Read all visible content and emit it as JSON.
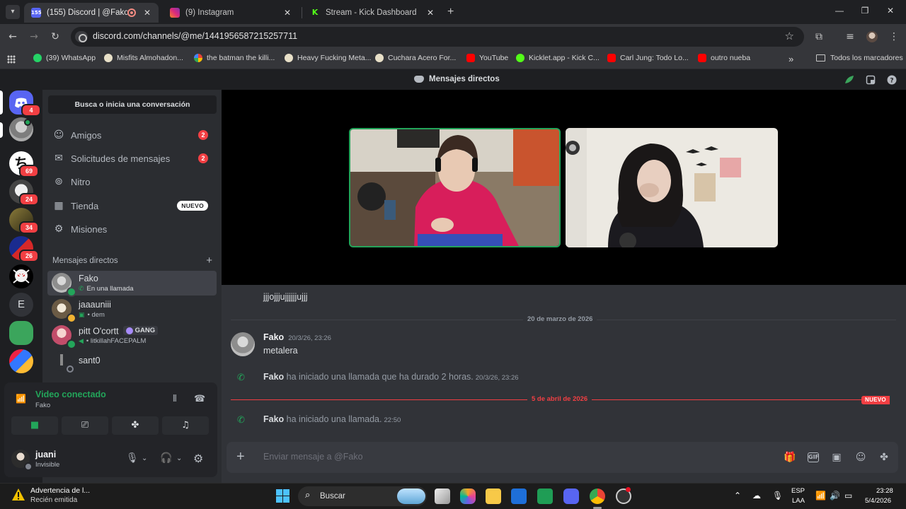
{
  "browser": {
    "tabs": [
      {
        "badge": "155",
        "title": "(155) Discord | @Fako",
        "active": true
      },
      {
        "title": "(9) Instagram"
      },
      {
        "title": "Stream - Kick Dashboard"
      }
    ],
    "url": "discord.com/channels/@me/1441956587215257711",
    "bookmarks": [
      "(39) WhatsApp",
      "Misfits Almohadon...",
      "the batman the killi...",
      "Heavy Fucking Meta...",
      "Cuchara Acero For...",
      "YouTube",
      "Kicklet.app - Kick C...",
      "Carl Jung: Todo Lo...",
      "outro nueba"
    ],
    "overflow": "»",
    "all_bookmarks": "Todos los marcadores"
  },
  "discord": {
    "title": "Mensajes directos",
    "servers": [
      {
        "name": "discord-home",
        "badge": "4"
      },
      {
        "name": "server-2",
        "badge": ""
      },
      {
        "name": "server-3",
        "badge": "69"
      },
      {
        "name": "server-4",
        "badge": "24"
      },
      {
        "name": "server-5",
        "badge": "34"
      },
      {
        "name": "server-6",
        "badge": "26"
      },
      {
        "name": "server-7",
        "badge": ""
      },
      {
        "name": "server-8",
        "letter": "E"
      },
      {
        "name": "server-9",
        "badge": ""
      },
      {
        "name": "server-10",
        "badge": ""
      }
    ],
    "search_placeholder": "Busca o inicia una conversación",
    "nav": [
      {
        "label": "Amigos",
        "count": "2"
      },
      {
        "label": "Solicitudes de mensajes",
        "count": "2"
      },
      {
        "label": "Nitro"
      },
      {
        "label": "Tienda",
        "tag": "NUEVO"
      },
      {
        "label": "Misiones"
      }
    ],
    "dm_header": "Mensajes directos",
    "dms": [
      {
        "name": "Fako",
        "sub": "En una llamada"
      },
      {
        "name": "jaaauniii",
        "sub": "• dem"
      },
      {
        "name": "pitt O'cortt",
        "tag": "GANG",
        "sub": "• litkillahFACEPALM"
      },
      {
        "name": "sant0",
        "sub": ""
      }
    ],
    "voice": {
      "title": "Video conectado",
      "channel": "Fako"
    },
    "user": {
      "name": "juani",
      "status": "Invisible"
    },
    "messages": {
      "first_line": "jjjojjjujjjjjjujjj",
      "date1": "20 de marzo de 2026",
      "author": "Fako",
      "author_ts": "20/3/26, 23:26",
      "text": "metalera",
      "call1_author": "Fako",
      "call1_text": "ha iniciado una llamada que ha durado 2 horas.",
      "call1_ts": "20/3/26, 23:26",
      "date2": "5 de abril de 2026",
      "new_flag": "NUEVO",
      "call2_author": "Fako",
      "call2_text": "ha iniciado una llamada.",
      "call2_ts": "22:50"
    },
    "composer_placeholder": "Enviar mensaje a @Fako"
  },
  "taskbar": {
    "notif_title": "Advertencia de l...",
    "notif_sub": "Recién emitida",
    "search": "Buscar",
    "lang1": "ESP",
    "lang2": "LAA",
    "time": "23:28",
    "date": "5/4/2026"
  }
}
